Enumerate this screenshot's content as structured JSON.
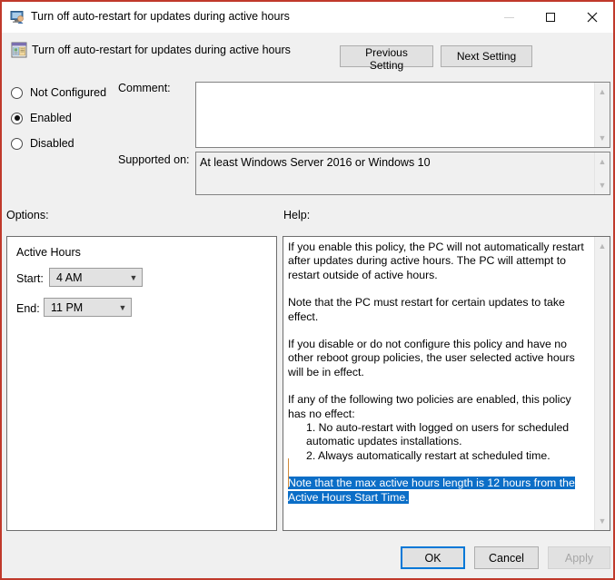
{
  "window": {
    "title": "Turn off auto-restart for updates during active hours",
    "titlebar_icon": "computer-user-icon",
    "controls": {
      "minimize": "minimize-icon",
      "maximize": "maximize-icon",
      "close": "close-icon"
    }
  },
  "header": {
    "icon": "group-policy-setting-icon",
    "title": "Turn off auto-restart for updates during active hours",
    "previous_setting": "Previous Setting",
    "next_setting": "Next Setting"
  },
  "state": {
    "options": [
      "Not Configured",
      "Enabled",
      "Disabled"
    ],
    "selected": "Enabled"
  },
  "comment": {
    "label": "Comment:",
    "value": ""
  },
  "supported_on": {
    "label": "Supported on:",
    "value": "At least Windows Server 2016 or Windows 10"
  },
  "sections": {
    "options_label": "Options:",
    "help_label": "Help:"
  },
  "options_panel": {
    "group_title": "Active Hours",
    "start": {
      "label": "Start:",
      "value": "4 AM"
    },
    "end": {
      "label": "End:",
      "value": "11 PM"
    }
  },
  "help": {
    "paragraphs": [
      "If you enable this policy, the PC will not automatically restart after updates during active hours. The PC will attempt to restart outside of active hours.",
      "Note that the PC must restart for certain updates to take effect.",
      "If you disable or do not configure this policy and have no other reboot group policies, the user selected active hours will be in effect."
    ],
    "conditions_intro": "If any of the following two policies are enabled, this policy has no effect:",
    "conditions": [
      "1. No auto-restart with logged on users for scheduled automatic updates installations.",
      "2. Always automatically restart at scheduled time."
    ],
    "selected_note": "Note that the max active hours length is 12 hours from the Active Hours Start Time.",
    "selection_color": "#0b6ec7"
  },
  "footer": {
    "ok": "OK",
    "cancel": "Cancel",
    "apply": "Apply",
    "apply_disabled": true,
    "focus_color": "#0078d7"
  }
}
